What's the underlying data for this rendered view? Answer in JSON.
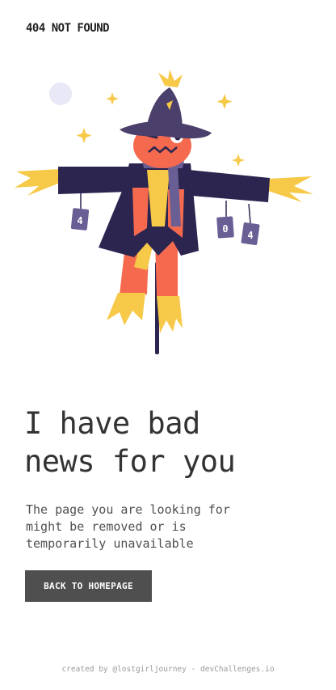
{
  "header": {
    "brand": "404 NOT FOUND"
  },
  "illustration": {
    "cans": [
      "4",
      "0",
      "4"
    ]
  },
  "main": {
    "headline_line1": "I have bad",
    "headline_line2": "news for you",
    "description_line1": "The page you are looking for",
    "description_line2": "might be removed or is",
    "description_line3": "temporarily unavailable",
    "button_label": "BACK TO HOMEPAGE"
  },
  "footer": {
    "text_prefix": "created by ",
    "author": "@lostgirljourney",
    "separator": " - ",
    "site": "devChallenges.io"
  },
  "colors": {
    "hat": "#4b3f6b",
    "coat": "#2b2550",
    "face": "#f56a4f",
    "straw": "#f7c948",
    "button_bg": "#4f4f4f"
  }
}
